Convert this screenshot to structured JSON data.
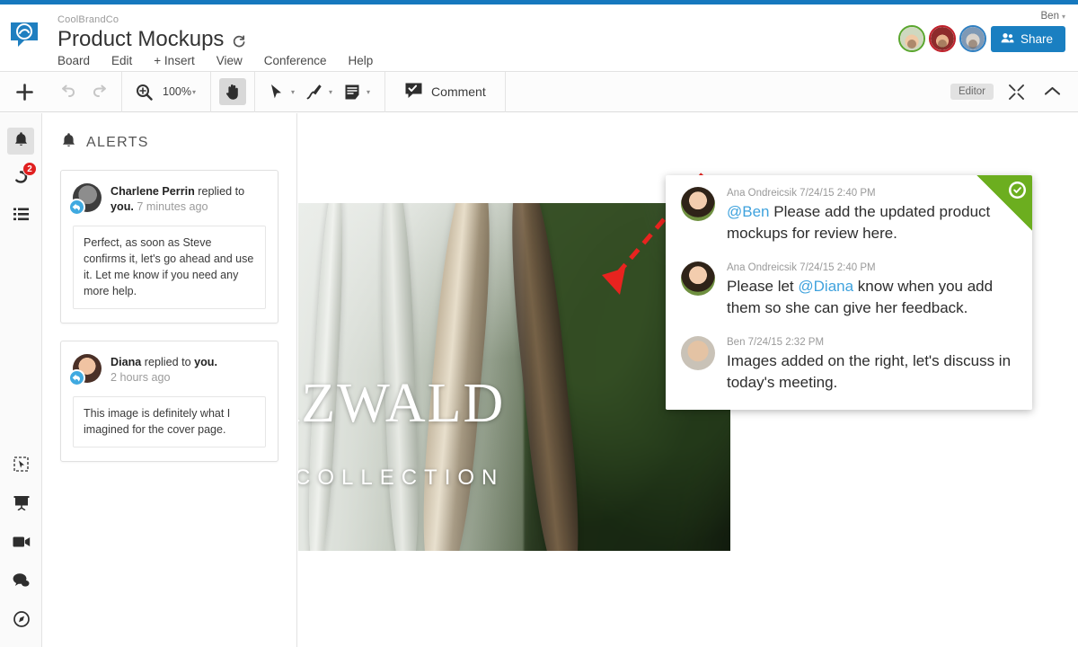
{
  "app": {
    "company": "CoolBrandCo",
    "board_title": "Product Mockups",
    "logo_icon": "speech-bubble-logo",
    "sync_icon": "sync-refresh-icon",
    "accent_color": "#1678be",
    "approved_color": "#6cae1f",
    "badge_color": "#e02020"
  },
  "menu": {
    "items": [
      {
        "label": "Board"
      },
      {
        "label": "Edit"
      },
      {
        "label": "+ Insert"
      },
      {
        "label": "View"
      },
      {
        "label": "Conference"
      },
      {
        "label": "Help"
      }
    ]
  },
  "header": {
    "user_name": "Ben",
    "user_caret": "▾",
    "share_label": "Share",
    "share_icon": "people-icon",
    "avatars": [
      {
        "name": "collaborator-1",
        "ring_color": "#5aa62e"
      },
      {
        "name": "collaborator-2",
        "ring_color": "#c0202a"
      },
      {
        "name": "collaborator-3",
        "ring_color": "#2f7fc1"
      }
    ]
  },
  "toolbar": {
    "add_icon": "plus-icon",
    "undo_icon": "undo-arrow-icon",
    "redo_icon": "redo-arrow-icon",
    "zoom_icon": "magnifier-plus-icon",
    "zoom_level": "100%",
    "caret": "▾",
    "hand_icon": "hand-pan-icon",
    "cursor_icon": "arrow-cursor-icon",
    "pen_icon": "pen-draw-icon",
    "note_icon": "sticky-note-icon",
    "comment_icon": "comment-bubble-icon",
    "comment_label": "Comment",
    "editor_chip": "Editor",
    "fullscreen_icon": "collapse-arrows-icon",
    "chevron_up_icon": "chevron-up-icon"
  },
  "rail": {
    "top": [
      {
        "name": "alerts-bell",
        "icon": "bell-icon",
        "active": true,
        "badge": ""
      },
      {
        "name": "replies",
        "icon": "reply-arrow-icon",
        "active": false,
        "badge": "2"
      },
      {
        "name": "activity-list",
        "icon": "list-icon",
        "active": false,
        "badge": ""
      }
    ],
    "bottom": [
      {
        "name": "select-frame",
        "icon": "select-frame-icon"
      },
      {
        "name": "presentation",
        "icon": "presentation-icon"
      },
      {
        "name": "video-call",
        "icon": "video-camera-icon"
      },
      {
        "name": "chat",
        "icon": "chat-bubbles-icon"
      },
      {
        "name": "compass",
        "icon": "compass-icon"
      }
    ]
  },
  "alerts": {
    "header_icon": "bell-icon",
    "header_title": "ALERTS",
    "items": [
      {
        "author": "Charlene Perrin",
        "action_pre": " replied to ",
        "target": "you.",
        "time": " 7 minutes ago",
        "quote": "Perfect, as soon as Steve confirms it, let's go ahead and use it. Let me know if you need any more help.",
        "avatar": "charlene-avatar",
        "overlay_icon": "reply-icon"
      },
      {
        "author": "Diana",
        "action_pre": " replied to ",
        "target": "you.",
        "time": "2 hours ago",
        "quote": "This image is definitely what I imagined for the cover page.",
        "avatar": "diana-avatar",
        "overlay_icon": "reply-icon"
      }
    ]
  },
  "board": {
    "image_name": "forest-cover-image",
    "wordmark": "RZWALD",
    "subword": "COLLECTION",
    "annotation_icon": "red-dashed-arrow"
  },
  "comment_thread": {
    "status_icon": "approved-check-icon",
    "comments": [
      {
        "author": "Ana Ondreicsik",
        "timestamp": "7/24/15 2:40 PM",
        "meta": "Ana Ondreicsik 7/24/15 2:40 PM",
        "mention": "@Ben",
        "text_after": " Please add the updated product mockups for review here.",
        "text_before": "",
        "avatar": "ana-avatar"
      },
      {
        "author": "Ana Ondreicsik",
        "timestamp": "7/24/15 2:40 PM",
        "meta": "Ana Ondreicsik 7/24/15 2:40 PM",
        "mention": "@Diana",
        "text_before": "Please let ",
        "text_after": " know when you add them so she can give her feedback.",
        "avatar": "ana-avatar"
      },
      {
        "author": "Ben",
        "timestamp": "7/24/15 2:32 PM",
        "meta": "Ben 7/24/15 2:32 PM",
        "mention": "",
        "text_before": "Images added on the right, let's discuss in today's meeting.",
        "text_after": "",
        "avatar": "ben-avatar"
      }
    ]
  }
}
